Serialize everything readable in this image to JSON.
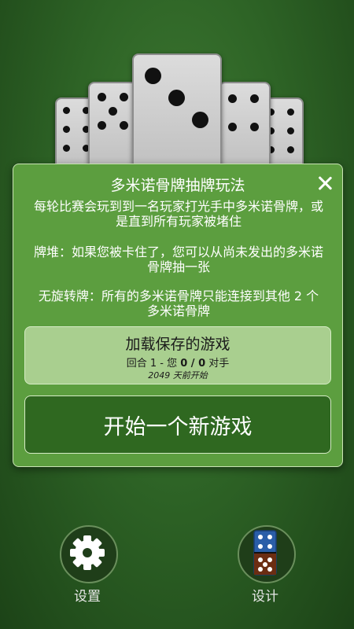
{
  "dialog": {
    "title": "多米诺骨牌抽牌玩法",
    "rules": [
      "每轮比赛会玩到到一名玩家打光手中多米诺骨牌，或是直到所有玩家被堵住",
      "牌堆：如果您被卡住了，您可以从尚未发出的多米诺骨牌抽一张",
      "无旋转牌：所有的多米诺骨牌只能连接到其他 2 个多米诺骨牌"
    ],
    "load_game": {
      "label": "加载保存的游戏",
      "round_prefix": "回合 1 - 您",
      "score": "0 / 0",
      "opponent_suffix": "对手",
      "started": "2049 天前开始"
    },
    "new_game_label": "开始一个新游戏"
  },
  "bottom_bar": {
    "settings_label": "设置",
    "design_label": "设计"
  },
  "colors": {
    "background": "#2e6426",
    "dialog": "#5c9e3f",
    "load_button": "#a9cf8f",
    "new_button": "#2f6820"
  }
}
